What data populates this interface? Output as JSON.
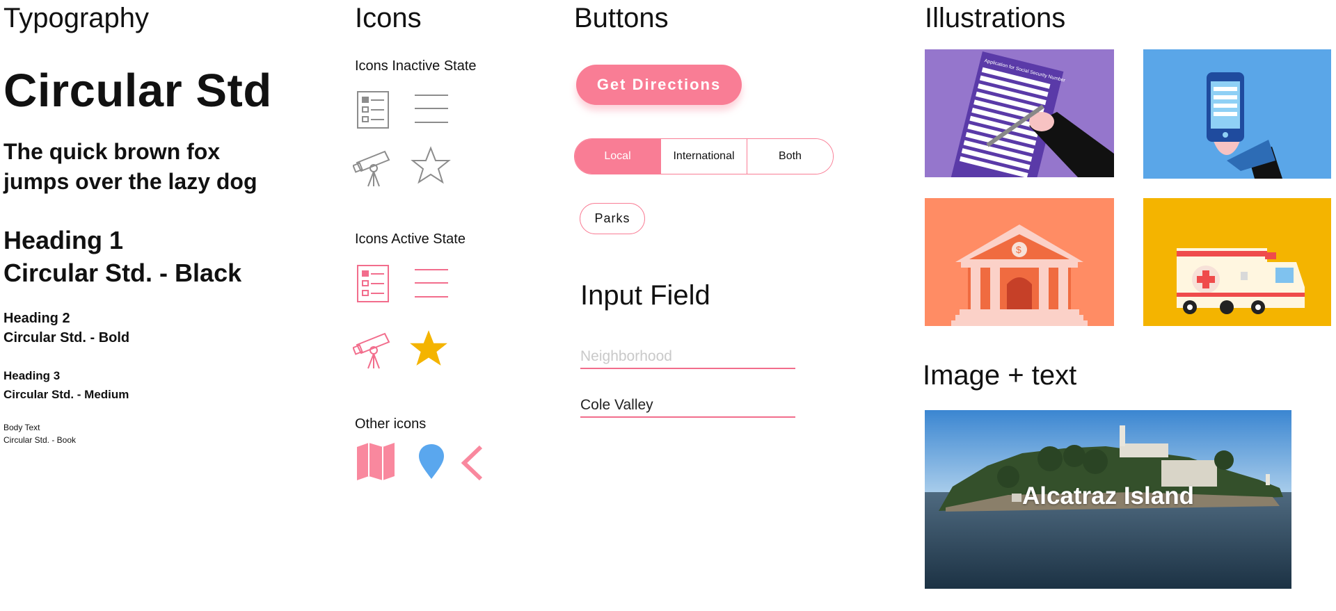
{
  "typography": {
    "title": "Typography",
    "font_name": "Circular Std",
    "pangram": "The quick brown fox jumps over the lazy dog",
    "heading1": [
      "Heading 1",
      "Circular Std. - Black"
    ],
    "heading2": [
      "Heading 2",
      "Circular Std. - Bold"
    ],
    "heading3": [
      "Heading 3",
      "Circular Std. - Medium"
    ],
    "body": [
      "Body Text",
      "Circular Std. - Book"
    ]
  },
  "icons": {
    "title": "Icons",
    "inactive_label": "Icons Inactive State",
    "active_label": "Icons Active State",
    "other_label": "Other icons",
    "inactive_color": "#8c8c8c",
    "active_color": "#f26d8c",
    "star_active_color": "#f4b400",
    "other": [
      {
        "name": "map-icon",
        "color": "#f9889e"
      },
      {
        "name": "location-pin-icon",
        "color": "#5aa7ee"
      },
      {
        "name": "chevron-left-icon",
        "color": "#f9889e"
      }
    ]
  },
  "buttons": {
    "title": "Buttons",
    "primary": "Get Directions",
    "segments": [
      "Local",
      "International",
      "Both"
    ],
    "active_segment": "Local",
    "chip": "Parks",
    "accent": "#f97d95"
  },
  "input": {
    "title": "Input Field",
    "placeholder": "Neighborhood",
    "value": "Cole Valley"
  },
  "illustrations": {
    "title": "Illustrations",
    "form_heading": "Application for Social Security Number",
    "tiles": [
      {
        "name": "application-form",
        "bg": "#9576cc"
      },
      {
        "name": "phone-in-hand",
        "bg": "#5aa6e8"
      },
      {
        "name": "bank-building",
        "bg": "#ff8c64"
      },
      {
        "name": "ambulance",
        "bg": "#f4b400"
      }
    ]
  },
  "image_text": {
    "title": "Image + text",
    "caption": "Alcatraz Island"
  }
}
